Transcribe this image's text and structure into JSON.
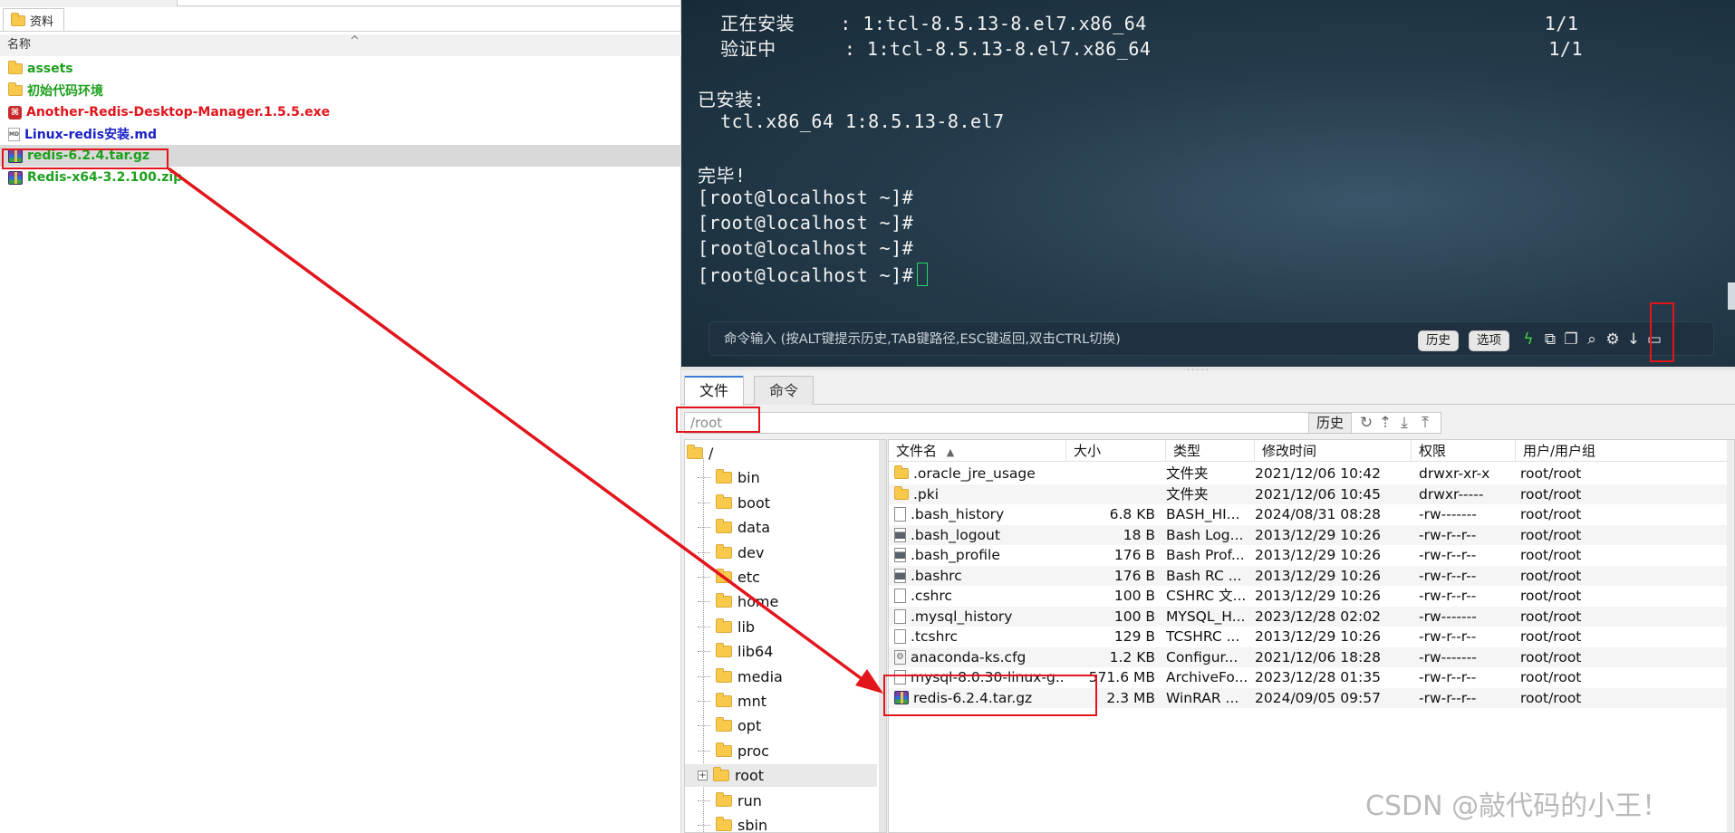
{
  "explorer": {
    "tab_label": "资料",
    "column_name": "名称",
    "sort_caret": "^",
    "files": [
      {
        "name": "assets",
        "icon": "folder-icon",
        "color": "#1ea01e"
      },
      {
        "name": "初始代码环境",
        "icon": "folder-icon",
        "color": "#1ea01e"
      },
      {
        "name": "Another-Redis-Desktop-Manager.1.5.5.exe",
        "icon": "app-icon",
        "color": "#e0151b"
      },
      {
        "name": "Linux-redis安装.md",
        "icon": "markdown-file-icon",
        "color": "#1b22c6"
      },
      {
        "name": "redis-6.2.4.tar.gz",
        "icon": "winrar-archive-icon",
        "color": "#1ea01e",
        "selected": true
      },
      {
        "name": "Redis-x64-3.2.100.zip",
        "icon": "winrar-archive-icon",
        "color": "#1ea01e"
      }
    ]
  },
  "terminal": {
    "lines": [
      {
        "text": "  正在安装    : 1:tcl-8.5.13-8.el7.x86_64                                   1/1"
      },
      {
        "text": "  验证中      : 1:tcl-8.5.13-8.el7.x86_64                                   1/1"
      },
      {
        "text": ""
      },
      {
        "text": "已安装:"
      },
      {
        "text": "  tcl.x86_64 1:8.5.13-8.el7"
      },
      {
        "text": ""
      },
      {
        "text": "完毕!"
      },
      {
        "text": "[root@localhost ~]#"
      },
      {
        "text": "[root@localhost ~]#"
      },
      {
        "text": "[root@localhost ~]#"
      },
      {
        "text": "[root@localhost ~]#"
      }
    ],
    "command_hint": "命令输入 (按ALT键提示历史,TAB键路径,ESC键返回,双击CTRL切换)",
    "history_button": "历史",
    "options_button": "选项"
  },
  "filemgr": {
    "tabs": [
      "文件",
      "命令"
    ],
    "path_value": "/root",
    "history_button": "历史",
    "tree": [
      {
        "name": "/",
        "level": 0
      },
      {
        "name": "bin",
        "level": 1
      },
      {
        "name": "boot",
        "level": 1
      },
      {
        "name": "data",
        "level": 1
      },
      {
        "name": "dev",
        "level": 1
      },
      {
        "name": "etc",
        "level": 1
      },
      {
        "name": "home",
        "level": 1
      },
      {
        "name": "lib",
        "level": 1
      },
      {
        "name": "lib64",
        "level": 1
      },
      {
        "name": "media",
        "level": 1
      },
      {
        "name": "mnt",
        "level": 1
      },
      {
        "name": "opt",
        "level": 1
      },
      {
        "name": "proc",
        "level": 1
      },
      {
        "name": "root",
        "level": 1,
        "selected": true,
        "expander": "+"
      },
      {
        "name": "run",
        "level": 1
      },
      {
        "name": "sbin",
        "level": 1
      }
    ],
    "columns": {
      "name": "文件名",
      "size": "大小",
      "type": "类型",
      "modified": "修改时间",
      "permissions": "权限",
      "owner": "用户/用户组",
      "sort_indicator": "▲"
    },
    "files": [
      {
        "name": ".oracle_jre_usage",
        "size": "",
        "type": "文件夹",
        "modified": "2021/12/06 10:42",
        "permissions": "drwxr-xr-x",
        "owner": "root/root",
        "icon": "folder-icon"
      },
      {
        "name": ".pki",
        "size": "",
        "type": "文件夹",
        "modified": "2021/12/06 10:45",
        "permissions": "drwxr-----",
        "owner": "root/root",
        "icon": "folder-icon"
      },
      {
        "name": ".bash_history",
        "size": "6.8 KB",
        "type": "BASH_HI...",
        "modified": "2024/08/31 08:28",
        "permissions": "-rw-------",
        "owner": "root/root",
        "icon": "file-icon"
      },
      {
        "name": ".bash_logout",
        "size": "18 B",
        "type": "Bash Log...",
        "modified": "2013/12/29 10:26",
        "permissions": "-rw-r--r--",
        "owner": "root/root",
        "icon": "script-file-icon"
      },
      {
        "name": ".bash_profile",
        "size": "176 B",
        "type": "Bash Prof...",
        "modified": "2013/12/29 10:26",
        "permissions": "-rw-r--r--",
        "owner": "root/root",
        "icon": "script-file-icon"
      },
      {
        "name": ".bashrc",
        "size": "176 B",
        "type": "Bash RC ...",
        "modified": "2013/12/29 10:26",
        "permissions": "-rw-r--r--",
        "owner": "root/root",
        "icon": "script-file-icon"
      },
      {
        "name": ".cshrc",
        "size": "100 B",
        "type": "CSHRC 文...",
        "modified": "2013/12/29 10:26",
        "permissions": "-rw-r--r--",
        "owner": "root/root",
        "icon": "file-icon"
      },
      {
        "name": ".mysql_history",
        "size": "100 B",
        "type": "MYSQL_H...",
        "modified": "2023/12/28 02:02",
        "permissions": "-rw-------",
        "owner": "root/root",
        "icon": "file-icon"
      },
      {
        "name": ".tcshrc",
        "size": "129 B",
        "type": "TCSHRC ...",
        "modified": "2013/12/29 10:26",
        "permissions": "-rw-r--r--",
        "owner": "root/root",
        "icon": "file-icon"
      },
      {
        "name": "anaconda-ks.cfg",
        "size": "1.2 KB",
        "type": "Configur...",
        "modified": "2021/12/06 18:28",
        "permissions": "-rw-------",
        "owner": "root/root",
        "icon": "config-file-icon"
      },
      {
        "name": "mysql-8.0.30-linux-g...",
        "size": "571.6 MB",
        "type": "ArchiveFo...",
        "modified": "2023/12/28 01:35",
        "permissions": "-rw-r--r--",
        "owner": "root/root",
        "icon": "file-icon"
      },
      {
        "name": "redis-6.2.4.tar.gz",
        "size": "2.3 MB",
        "type": "WinRAR ...",
        "modified": "2024/09/05 09:57",
        "permissions": "-rw-r--r--",
        "owner": "root/root",
        "icon": "winrar-archive-icon"
      }
    ]
  },
  "watermark": "CSDN @敲代码的小王！",
  "colors": {
    "annotation": "#e3141b",
    "terminal_bg": "#253c4c",
    "cursor": "#27d36a"
  }
}
